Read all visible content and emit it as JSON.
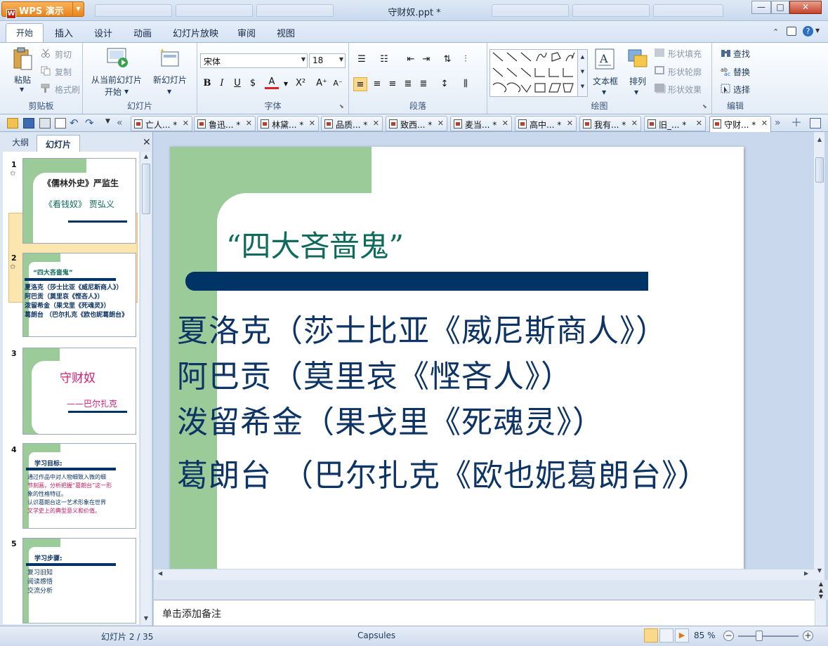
{
  "app": {
    "name": "WPS 演示",
    "logo_char": "W",
    "window_title": "守财奴.ppt *",
    "controls": {
      "minimize": "—",
      "maximize": "□",
      "close": "✕"
    }
  },
  "menu_tabs": [
    "开始",
    "插入",
    "设计",
    "动画",
    "幻灯片放映",
    "审阅",
    "视图"
  ],
  "ribbon": {
    "clipboard": {
      "paste": "粘贴",
      "cut": "剪切",
      "copy": "复制",
      "format_painter": "格式刷",
      "label": "剪贴板"
    },
    "slides": {
      "from_current_line1": "从当前幻灯片",
      "from_current_line2": "开始",
      "new_slide": "新幻灯片",
      "label": "幻灯片"
    },
    "font": {
      "font_name": "宋体",
      "font_size": "18",
      "label": "字体"
    },
    "paragraph": {
      "label": "段落"
    },
    "drawing": {
      "textbox": "文本框",
      "arrange": "排列",
      "shape_fill": "形状填充",
      "shape_outline": "形状轮廓",
      "shape_effect": "形状效果",
      "label": "绘图"
    },
    "editing": {
      "find": "查找",
      "replace": "替换",
      "select": "选择",
      "label": "编辑"
    }
  },
  "doc_tabs": [
    "亡人... *",
    "鲁迅... *",
    "林黛... *",
    "品质... *",
    "致西... *",
    "麦当... *",
    "高中... *",
    "我有... *",
    "旧_... *",
    "守财... *"
  ],
  "left_panel": {
    "tabs": [
      "大纲",
      "幻灯片"
    ],
    "close": "✕",
    "thumbnails": [
      {
        "num": "1",
        "title": "《儒林外史》严监生",
        "subtitle": "《看钱奴》 贾弘义"
      },
      {
        "num": "2",
        "title": "“四大吝啬鬼”",
        "lines": [
          "夏洛克（莎士比亚《威尼斯商人》）",
          "阿巴贡（莫里哀《悭吝人》）",
          "泼留希金（果戈里《死魂灵》）",
          "葛朗台 （巴尔扎克《欧也妮葛朗台》"
        ]
      },
      {
        "num": "3",
        "title": "守财奴",
        "subtitle": "——巴尔扎克"
      },
      {
        "num": "4",
        "title": "学习目标:",
        "lines": [
          "通过作品中对人物细致入微的细",
          "节刻画，分析把握“葛朗台”这一形",
          "象的性格特征。",
          "认识葛朗台这一艺术形象在世界",
          "文学史上的典型意义和价值。"
        ]
      },
      {
        "num": "5",
        "title": "学习步骤:",
        "lines": [
          "复习旧知",
          "阅读感悟",
          "交流分析"
        ]
      }
    ]
  },
  "slide": {
    "title": "“四大吝啬鬼”",
    "lines": [
      "夏洛克（莎士比亚《威尼斯商人》）",
      "阿巴贡（莫里哀《悭吝人》）",
      "泼留希金（果戈里《死魂灵》）",
      "葛朗台 （巴尔扎克《欧也妮葛朗台》）"
    ]
  },
  "notes_placeholder": "单击添加备注",
  "status": {
    "slide_info": "幻灯片 2 / 35",
    "theme": "Capsules",
    "zoom": "85 %",
    "zoom_level": 0.35
  }
}
